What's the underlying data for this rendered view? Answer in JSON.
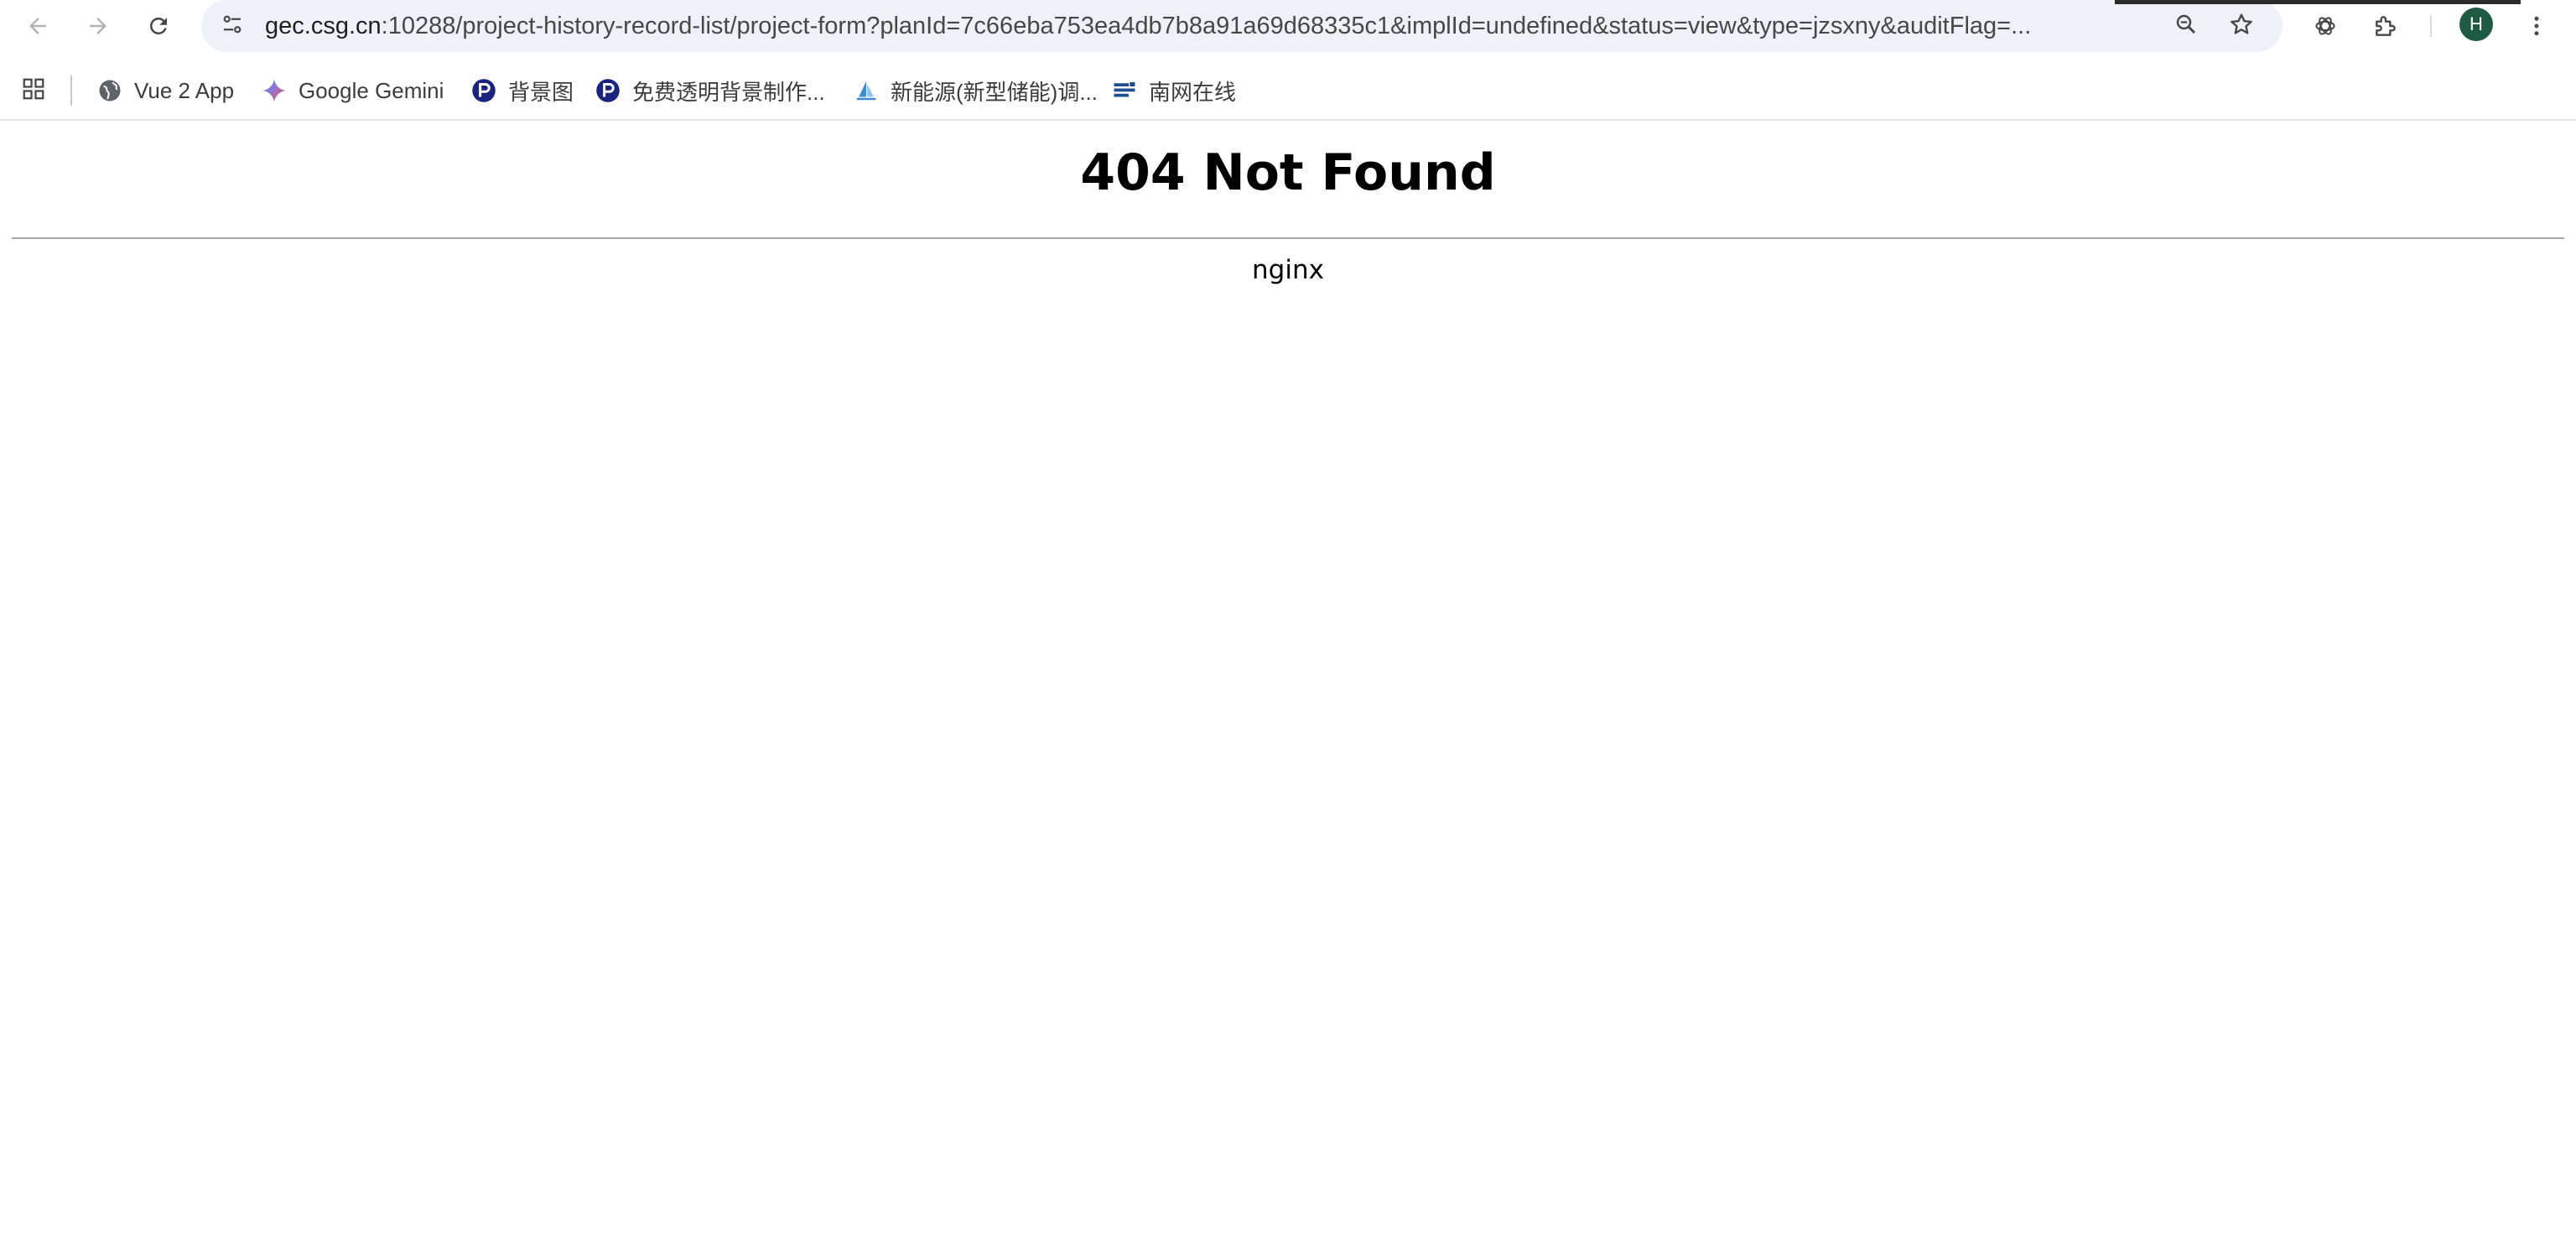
{
  "browser": {
    "url_host": "gec.csg.cn",
    "url_rest": ":10288/project-history-record-list/project-form?planId=7c66eba753ea4db7b8a91a69d68335c1&implId=undefined&status=view&type=jzsxny&auditFlag=...",
    "profile_initial": "H",
    "icons": {
      "back": "back-arrow-icon",
      "forward": "forward-arrow-icon",
      "reload": "reload-icon",
      "site_info": "tune-icon",
      "zoom": "zoom-icon",
      "bookmark": "star-icon",
      "extension_1": "openai-icon",
      "extensions": "puzzle-icon",
      "menu": "kebab-menu-icon"
    }
  },
  "bookmarks": [
    {
      "label": "Vue 2 App",
      "icon": "globe-icon"
    },
    {
      "label": "Google Gemini",
      "icon": "gemini-icon"
    },
    {
      "label": "背景图",
      "icon": "p-logo-icon"
    },
    {
      "label": "免费透明背景制作...",
      "icon": "p-logo-icon"
    },
    {
      "label": "新能源(新型储能)调...",
      "icon": "sail-icon"
    },
    {
      "label": "南网在线",
      "icon": "csg-logo-icon"
    }
  ],
  "page": {
    "title": "404 Not Found",
    "server": "nginx"
  },
  "colors": {
    "omnibox_bg": "#eef1f8",
    "avatar_bg": "#1f5a44",
    "p_logo": "#1a237e",
    "csg_blue": "#1d4f91"
  }
}
